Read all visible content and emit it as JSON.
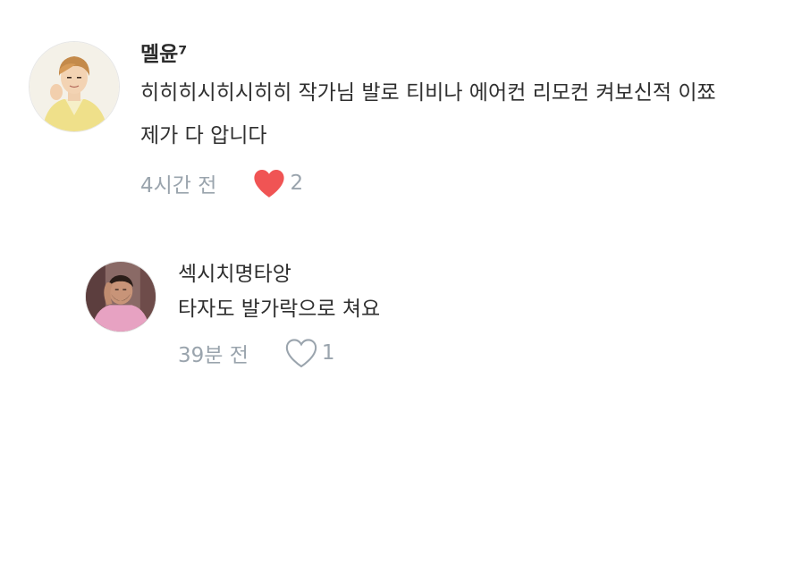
{
  "comments": [
    {
      "author": "멜윤⁷",
      "lines": [
        "히히히시히시히히 작가님 발로 티비나 에어컨 리모컨 켜보신적 이쬬",
        "제가 다 압니다"
      ],
      "time": "4시간 전",
      "liked": true,
      "like_count": "2",
      "heart_icon": "heart-filled-icon",
      "like_color": "#f05454"
    },
    {
      "author": "섹시치명타앙",
      "lines": [
        "타자도 발가락으로 쳐요"
      ],
      "time": "39분 전",
      "liked": false,
      "like_count": "1",
      "heart_icon": "heart-outline-icon",
      "like_color": "#9aa4ad"
    }
  ]
}
